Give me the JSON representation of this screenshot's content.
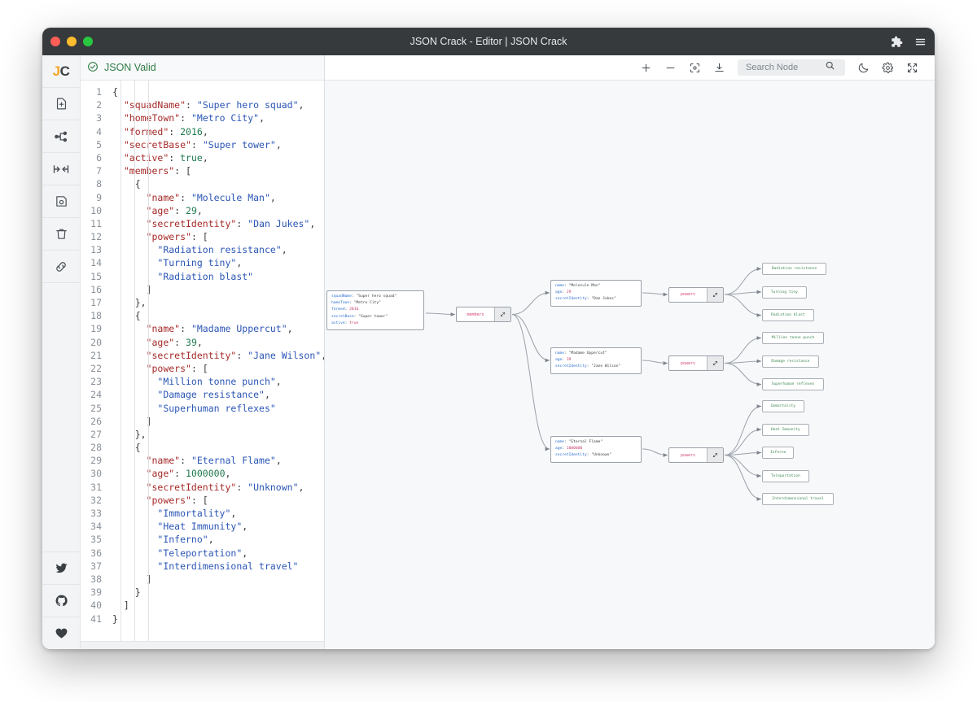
{
  "window": {
    "title": "JSON Crack - Editor | JSON Crack",
    "traffic": {
      "close": "close-button",
      "minimize": "minimize-button",
      "maximize": "maximize-button"
    },
    "right_icons": [
      {
        "name": "extensions-icon",
        "label": "Extensions"
      },
      {
        "name": "menu-icon",
        "label": "Menu"
      }
    ]
  },
  "rail": {
    "logo": {
      "j": "J",
      "c": "C"
    },
    "items": [
      {
        "name": "new-document-icon",
        "label": "New document"
      },
      {
        "name": "share-graph-icon",
        "label": "Share graph"
      },
      {
        "name": "collapse-icon",
        "label": "Collapse"
      },
      {
        "name": "save-icon",
        "label": "Save"
      },
      {
        "name": "delete-icon",
        "label": "Delete"
      },
      {
        "name": "link-icon",
        "label": "Link"
      }
    ],
    "bottom_items": [
      {
        "name": "twitter-icon",
        "label": "Twitter"
      },
      {
        "name": "github-icon",
        "label": "GitHub"
      },
      {
        "name": "heart-icon",
        "label": "Sponsor"
      }
    ]
  },
  "status": {
    "text": "JSON Valid",
    "color": "#2e7d46"
  },
  "toolbar": {
    "zoom_in": "+",
    "zoom_out": "−",
    "center_label": "Center view",
    "download_label": "Download",
    "search": {
      "placeholder": "Search Node",
      "value": ""
    },
    "dark_mode_label": "Toggle dark mode",
    "settings_label": "Settings",
    "fullscreen_label": "Fullscreen"
  },
  "editor": {
    "line_numbers": [
      1,
      2,
      3,
      4,
      5,
      6,
      7,
      8,
      9,
      10,
      11,
      12,
      13,
      14,
      15,
      16,
      17,
      18,
      19,
      20,
      21,
      22,
      23,
      24,
      25,
      26,
      27,
      28,
      29,
      30,
      31,
      32,
      33,
      34,
      35,
      36,
      37,
      38,
      39,
      40,
      41
    ],
    "lines": [
      [
        {
          "t": "punc",
          "v": "{"
        }
      ],
      [
        {
          "t": "punc",
          "v": "  "
        },
        {
          "t": "key",
          "v": "\"squadName\""
        },
        {
          "t": "punc",
          "v": ": "
        },
        {
          "t": "str",
          "v": "\"Super hero squad\""
        },
        {
          "t": "punc",
          "v": ","
        }
      ],
      [
        {
          "t": "punc",
          "v": "  "
        },
        {
          "t": "key",
          "v": "\"homeTown\""
        },
        {
          "t": "punc",
          "v": ": "
        },
        {
          "t": "str",
          "v": "\"Metro City\""
        },
        {
          "t": "punc",
          "v": ","
        }
      ],
      [
        {
          "t": "punc",
          "v": "  "
        },
        {
          "t": "key",
          "v": "\"formed\""
        },
        {
          "t": "punc",
          "v": ": "
        },
        {
          "t": "num",
          "v": "2016"
        },
        {
          "t": "punc",
          "v": ","
        }
      ],
      [
        {
          "t": "punc",
          "v": "  "
        },
        {
          "t": "key",
          "v": "\"secretBase\""
        },
        {
          "t": "punc",
          "v": ": "
        },
        {
          "t": "str",
          "v": "\"Super tower\""
        },
        {
          "t": "punc",
          "v": ","
        }
      ],
      [
        {
          "t": "punc",
          "v": "  "
        },
        {
          "t": "key",
          "v": "\"active\""
        },
        {
          "t": "punc",
          "v": ": "
        },
        {
          "t": "bool",
          "v": "true"
        },
        {
          "t": "punc",
          "v": ","
        }
      ],
      [
        {
          "t": "punc",
          "v": "  "
        },
        {
          "t": "key",
          "v": "\"members\""
        },
        {
          "t": "punc",
          "v": ": ["
        }
      ],
      [
        {
          "t": "punc",
          "v": "    {"
        }
      ],
      [
        {
          "t": "punc",
          "v": "      "
        },
        {
          "t": "key",
          "v": "\"name\""
        },
        {
          "t": "punc",
          "v": ": "
        },
        {
          "t": "str",
          "v": "\"Molecule Man\""
        },
        {
          "t": "punc",
          "v": ","
        }
      ],
      [
        {
          "t": "punc",
          "v": "      "
        },
        {
          "t": "key",
          "v": "\"age\""
        },
        {
          "t": "punc",
          "v": ": "
        },
        {
          "t": "num",
          "v": "29"
        },
        {
          "t": "punc",
          "v": ","
        }
      ],
      [
        {
          "t": "punc",
          "v": "      "
        },
        {
          "t": "key",
          "v": "\"secretIdentity\""
        },
        {
          "t": "punc",
          "v": ": "
        },
        {
          "t": "str",
          "v": "\"Dan Jukes\""
        },
        {
          "t": "punc",
          "v": ","
        }
      ],
      [
        {
          "t": "punc",
          "v": "      "
        },
        {
          "t": "key",
          "v": "\"powers\""
        },
        {
          "t": "punc",
          "v": ": ["
        }
      ],
      [
        {
          "t": "punc",
          "v": "        "
        },
        {
          "t": "str",
          "v": "\"Radiation resistance\""
        },
        {
          "t": "punc",
          "v": ","
        }
      ],
      [
        {
          "t": "punc",
          "v": "        "
        },
        {
          "t": "str",
          "v": "\"Turning tiny\""
        },
        {
          "t": "punc",
          "v": ","
        }
      ],
      [
        {
          "t": "punc",
          "v": "        "
        },
        {
          "t": "str",
          "v": "\"Radiation blast\""
        }
      ],
      [
        {
          "t": "punc",
          "v": "      ]"
        }
      ],
      [
        {
          "t": "punc",
          "v": "    },"
        }
      ],
      [
        {
          "t": "punc",
          "v": "    {"
        }
      ],
      [
        {
          "t": "punc",
          "v": "      "
        },
        {
          "t": "key",
          "v": "\"name\""
        },
        {
          "t": "punc",
          "v": ": "
        },
        {
          "t": "str",
          "v": "\"Madame Uppercut\""
        },
        {
          "t": "punc",
          "v": ","
        }
      ],
      [
        {
          "t": "punc",
          "v": "      "
        },
        {
          "t": "key",
          "v": "\"age\""
        },
        {
          "t": "punc",
          "v": ": "
        },
        {
          "t": "num",
          "v": "39"
        },
        {
          "t": "punc",
          "v": ","
        }
      ],
      [
        {
          "t": "punc",
          "v": "      "
        },
        {
          "t": "key",
          "v": "\"secretIdentity\""
        },
        {
          "t": "punc",
          "v": ": "
        },
        {
          "t": "str",
          "v": "\"Jane Wilson\""
        },
        {
          "t": "punc",
          "v": ","
        }
      ],
      [
        {
          "t": "punc",
          "v": "      "
        },
        {
          "t": "key",
          "v": "\"powers\""
        },
        {
          "t": "punc",
          "v": ": ["
        }
      ],
      [
        {
          "t": "punc",
          "v": "        "
        },
        {
          "t": "str",
          "v": "\"Million tonne punch\""
        },
        {
          "t": "punc",
          "v": ","
        }
      ],
      [
        {
          "t": "punc",
          "v": "        "
        },
        {
          "t": "str",
          "v": "\"Damage resistance\""
        },
        {
          "t": "punc",
          "v": ","
        }
      ],
      [
        {
          "t": "punc",
          "v": "        "
        },
        {
          "t": "str",
          "v": "\"Superhuman reflexes\""
        }
      ],
      [
        {
          "t": "punc",
          "v": "      ]"
        }
      ],
      [
        {
          "t": "punc",
          "v": "    },"
        }
      ],
      [
        {
          "t": "punc",
          "v": "    {"
        }
      ],
      [
        {
          "t": "punc",
          "v": "      "
        },
        {
          "t": "key",
          "v": "\"name\""
        },
        {
          "t": "punc",
          "v": ": "
        },
        {
          "t": "str",
          "v": "\"Eternal Flame\""
        },
        {
          "t": "punc",
          "v": ","
        }
      ],
      [
        {
          "t": "punc",
          "v": "      "
        },
        {
          "t": "key",
          "v": "\"age\""
        },
        {
          "t": "punc",
          "v": ": "
        },
        {
          "t": "num",
          "v": "1000000"
        },
        {
          "t": "punc",
          "v": ","
        }
      ],
      [
        {
          "t": "punc",
          "v": "      "
        },
        {
          "t": "key",
          "v": "\"secretIdentity\""
        },
        {
          "t": "punc",
          "v": ": "
        },
        {
          "t": "str",
          "v": "\"Unknown\""
        },
        {
          "t": "punc",
          "v": ","
        }
      ],
      [
        {
          "t": "punc",
          "v": "      "
        },
        {
          "t": "key",
          "v": "\"powers\""
        },
        {
          "t": "punc",
          "v": ": ["
        }
      ],
      [
        {
          "t": "punc",
          "v": "        "
        },
        {
          "t": "str",
          "v": "\"Immortality\""
        },
        {
          "t": "punc",
          "v": ","
        }
      ],
      [
        {
          "t": "punc",
          "v": "        "
        },
        {
          "t": "str",
          "v": "\"Heat Immunity\""
        },
        {
          "t": "punc",
          "v": ","
        }
      ],
      [
        {
          "t": "punc",
          "v": "        "
        },
        {
          "t": "str",
          "v": "\"Inferno\""
        },
        {
          "t": "punc",
          "v": ","
        }
      ],
      [
        {
          "t": "punc",
          "v": "        "
        },
        {
          "t": "str",
          "v": "\"Teleportation\""
        },
        {
          "t": "punc",
          "v": ","
        }
      ],
      [
        {
          "t": "punc",
          "v": "        "
        },
        {
          "t": "str",
          "v": "\"Interdimensional travel\""
        }
      ],
      [
        {
          "t": "punc",
          "v": "      ]"
        }
      ],
      [
        {
          "t": "punc",
          "v": "    }"
        }
      ],
      [
        {
          "t": "punc",
          "v": "  ]"
        }
      ],
      [
        {
          "t": "punc",
          "v": "}"
        }
      ]
    ]
  },
  "graph": {
    "root_node": {
      "name": "graph-node-root",
      "rows": [
        {
          "key": "squadName",
          "value": "\"Super hero squad\"",
          "type": "string"
        },
        {
          "key": "homeTown",
          "value": "\"Metro City\"",
          "type": "string"
        },
        {
          "key": "formed",
          "value": "2016",
          "type": "number"
        },
        {
          "key": "secretBase",
          "value": "\"Super tower\"",
          "type": "string"
        },
        {
          "key": "active",
          "value": "true",
          "type": "boolean"
        }
      ]
    },
    "members_node": {
      "name": "graph-node-members",
      "label": "members"
    },
    "members": [
      {
        "name": "graph-node-member-molecule-man",
        "rows": [
          {
            "key": "name",
            "value": "\"Molecule Man\"",
            "type": "string"
          },
          {
            "key": "age",
            "value": "29",
            "type": "number"
          },
          {
            "key": "secretIdentity",
            "value": "\"Dan Jukes\"",
            "type": "string"
          }
        ],
        "powers_label": "powers",
        "powers": [
          "Radiation resistance",
          "Turning tiny",
          "Radiation blast"
        ]
      },
      {
        "name": "graph-node-member-madame-uppercut",
        "rows": [
          {
            "key": "name",
            "value": "\"Madame Uppercut\"",
            "type": "string"
          },
          {
            "key": "age",
            "value": "39",
            "type": "number"
          },
          {
            "key": "secretIdentity",
            "value": "\"Jane Wilson\"",
            "type": "string"
          }
        ],
        "powers_label": "powers",
        "powers": [
          "Million tonne punch",
          "Damage resistance",
          "Superhuman reflexes"
        ]
      },
      {
        "name": "graph-node-member-eternal-flame",
        "rows": [
          {
            "key": "name",
            "value": "\"Eternal Flame\"",
            "type": "string"
          },
          {
            "key": "age",
            "value": "1000000",
            "type": "number"
          },
          {
            "key": "secretIdentity",
            "value": "\"Unknown\"",
            "type": "string"
          }
        ],
        "powers_label": "powers",
        "powers": [
          "Immortality",
          "Heat Immunity",
          "Inferno",
          "Teleportation",
          "Interdimensional travel"
        ]
      }
    ]
  },
  "colors": {
    "titlebar": "#373a3d",
    "valid_green": "#2e7d46",
    "node_key_blue": "#2d6fd1",
    "node_value_pink": "#c43b63",
    "leaf_green": "#3f8a55",
    "parent_label_pink": "#d6437c",
    "logo_orange": "#f5a623"
  }
}
